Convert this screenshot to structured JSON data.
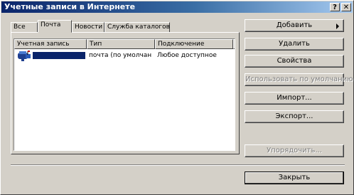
{
  "window": {
    "title": "Учетные записи в Интернете",
    "help_glyph": "?",
    "close_glyph": "✕"
  },
  "tabs": [
    {
      "label": "Все",
      "active": false
    },
    {
      "label": "Почта",
      "active": true
    },
    {
      "label": "Новости",
      "active": false
    },
    {
      "label": "Служба каталогов",
      "active": false
    }
  ],
  "list": {
    "columns": [
      "Учетная запись",
      "Тип",
      "Подключение"
    ],
    "rows": [
      {
        "icon": "mail-account-icon",
        "account": "",
        "type": "почта (по умолчан",
        "connection": "Любое доступное",
        "selected": true
      }
    ]
  },
  "buttons": {
    "add": "Добавить",
    "remove": "Удалить",
    "properties": "Свойства",
    "set_default": "Использовать по умолчанию",
    "import": "Импорт...",
    "export": "Экспорт...",
    "order": "Упорядочить...",
    "close": "Закрыть"
  },
  "colors": {
    "title_start": "#0a246a",
    "selection": "#0a246a",
    "face": "#d4d0c8"
  }
}
